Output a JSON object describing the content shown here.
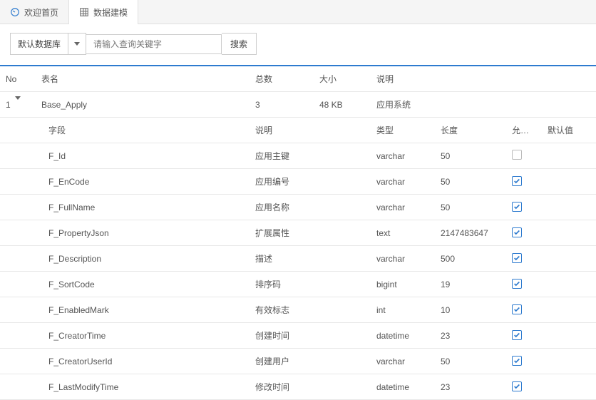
{
  "tabs": [
    {
      "label": "欢迎首页",
      "icon": "dashboard-icon",
      "active": false
    },
    {
      "label": "数据建模",
      "icon": "grid-icon",
      "active": true
    }
  ],
  "toolbar": {
    "db_select_label": "默认数据库",
    "search_placeholder": "请输入查询关键字",
    "search_button": "搜索"
  },
  "table": {
    "headers": {
      "no": "No",
      "name": "表名",
      "total": "总数",
      "size": "大小",
      "desc": "说明"
    },
    "rows": [
      {
        "no": "1",
        "name": "Base_Apply",
        "total": "3",
        "size": "48 KB",
        "desc": "应用系统"
      }
    ]
  },
  "nested": {
    "headers": {
      "field": "字段",
      "desc": "说明",
      "type": "类型",
      "len": "长度",
      "nullable": "允许空",
      "default": "默认值"
    },
    "rows": [
      {
        "field": "F_Id",
        "desc": "应用主键",
        "type": "varchar",
        "len": "50",
        "nullable": false
      },
      {
        "field": "F_EnCode",
        "desc": "应用编号",
        "type": "varchar",
        "len": "50",
        "nullable": true
      },
      {
        "field": "F_FullName",
        "desc": "应用名称",
        "type": "varchar",
        "len": "50",
        "nullable": true
      },
      {
        "field": "F_PropertyJson",
        "desc": "扩展属性",
        "type": "text",
        "len": "2147483647",
        "nullable": true
      },
      {
        "field": "F_Description",
        "desc": "描述",
        "type": "varchar",
        "len": "500",
        "nullable": true
      },
      {
        "field": "F_SortCode",
        "desc": "排序码",
        "type": "bigint",
        "len": "19",
        "nullable": true
      },
      {
        "field": "F_EnabledMark",
        "desc": "有效标志",
        "type": "int",
        "len": "10",
        "nullable": true
      },
      {
        "field": "F_CreatorTime",
        "desc": "创建时间",
        "type": "datetime",
        "len": "23",
        "nullable": true
      },
      {
        "field": "F_CreatorUserId",
        "desc": "创建用户",
        "type": "varchar",
        "len": "50",
        "nullable": true
      },
      {
        "field": "F_LastModifyTime",
        "desc": "修改时间",
        "type": "datetime",
        "len": "23",
        "nullable": true
      }
    ]
  }
}
